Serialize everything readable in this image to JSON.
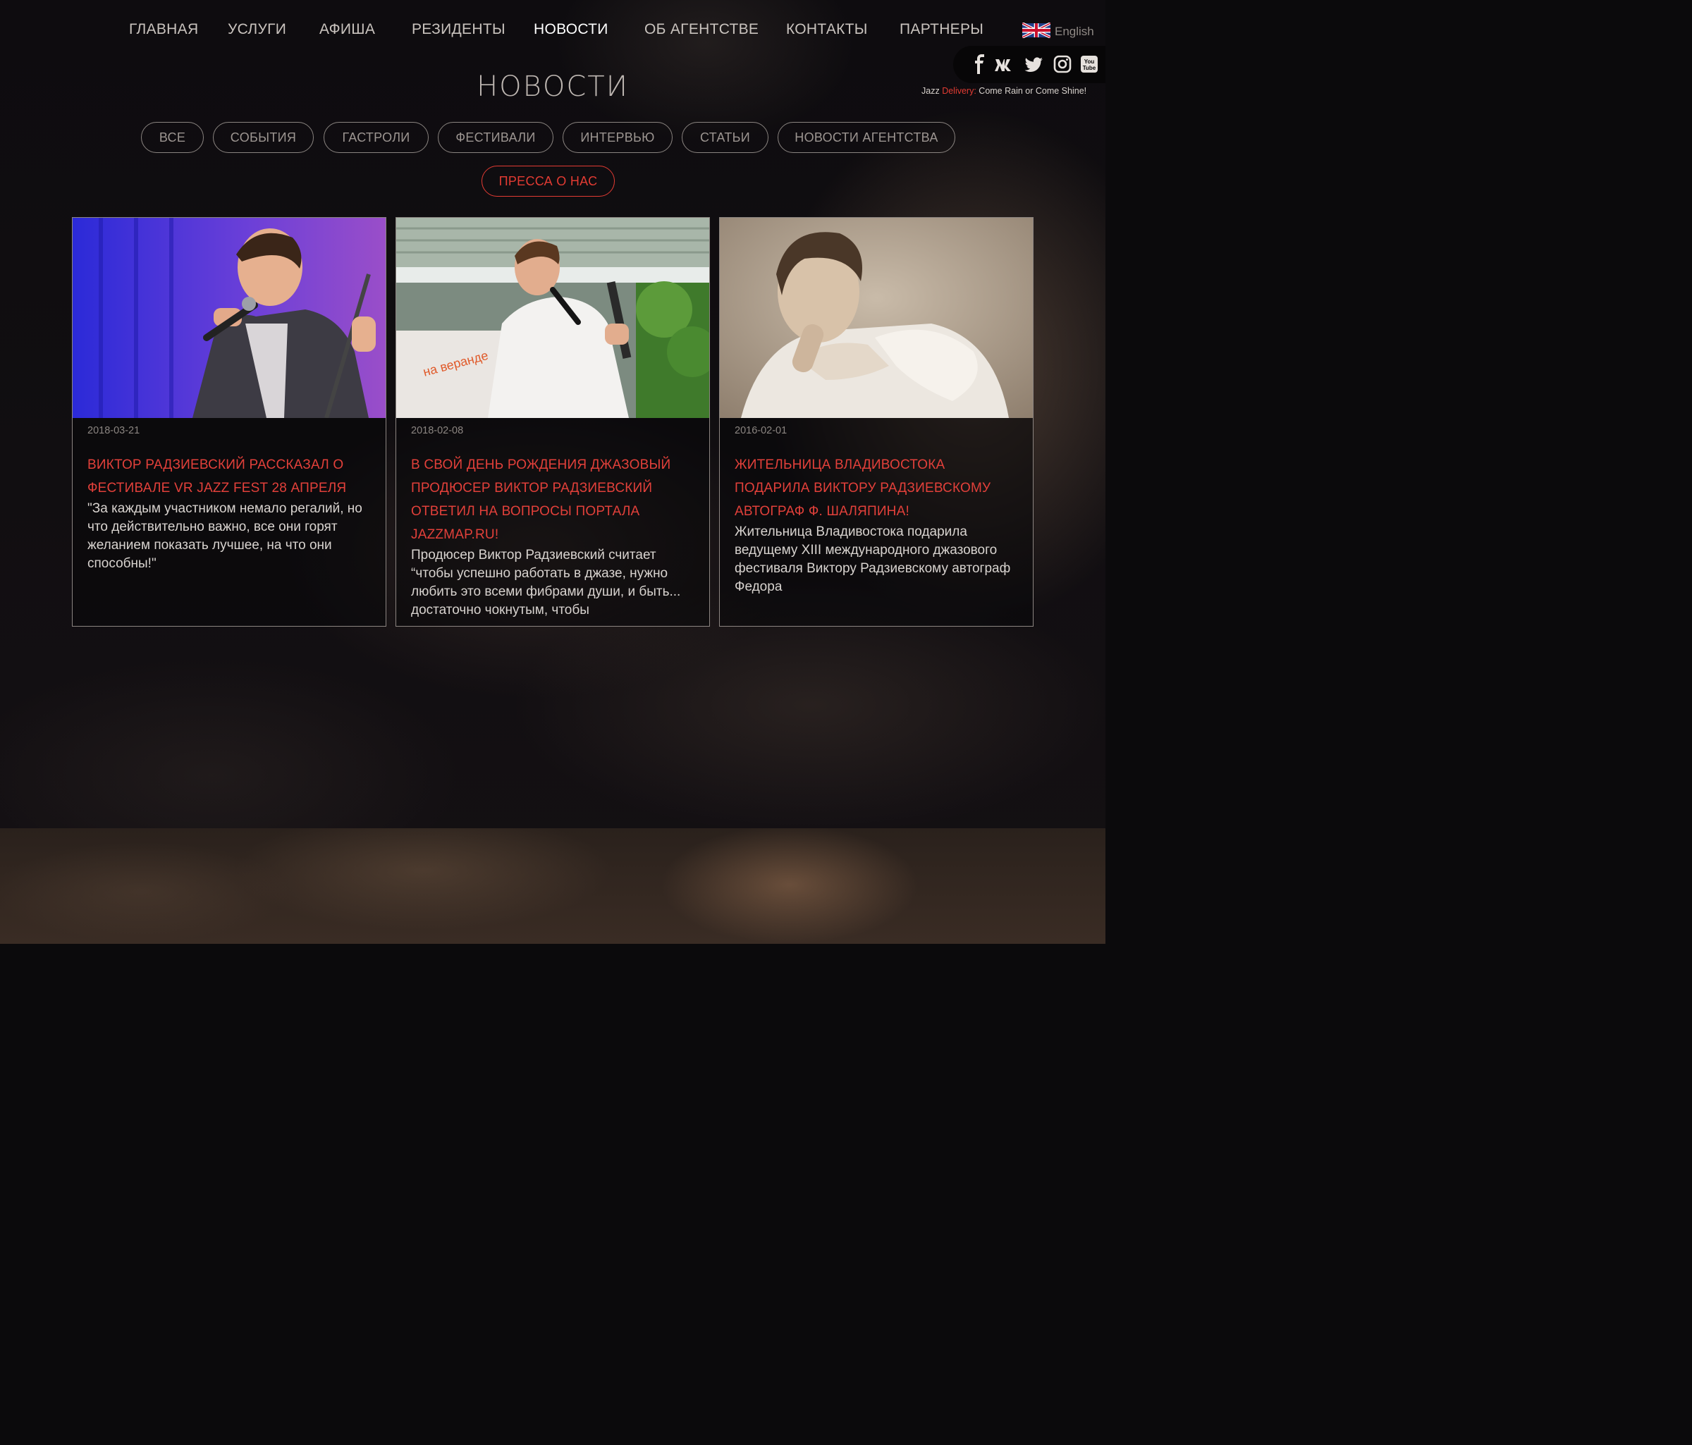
{
  "nav": {
    "items": [
      {
        "label": "ГЛАВНАЯ",
        "active": false
      },
      {
        "label": "УСЛУГИ",
        "active": false
      },
      {
        "label": "АФИША",
        "active": false
      },
      {
        "label": "РЕЗИДЕНТЫ",
        "active": false
      },
      {
        "label": "НОВОСТИ",
        "active": true
      },
      {
        "label": "ОБ АГЕНТСТВЕ",
        "active": false
      },
      {
        "label": "КОНТАКТЫ",
        "active": false
      },
      {
        "label": "ПАРТНЕРЫ",
        "active": false
      }
    ],
    "language": {
      "label": "English",
      "icon": "uk-flag-icon"
    }
  },
  "social": {
    "icons": [
      "facebook-icon",
      "vk-icon",
      "twitter-icon",
      "instagram-icon",
      "youtube-icon"
    ]
  },
  "tagline": {
    "prefix": "Jazz ",
    "accent": "Delivery:",
    "rest": " Come Rain or Come Shine!"
  },
  "page": {
    "title": "НОВОСТИ"
  },
  "filters": [
    {
      "label": "ВСЕ",
      "active": false
    },
    {
      "label": "СОБЫТИЯ",
      "active": false
    },
    {
      "label": "ГАСТРОЛИ",
      "active": false
    },
    {
      "label": "ФЕСТИВАЛИ",
      "active": false
    },
    {
      "label": "ИНТЕРВЬЮ",
      "active": false
    },
    {
      "label": "СТАТЬИ",
      "active": false
    },
    {
      "label": "НОВОСТИ АГЕНТСТВА",
      "active": false
    },
    {
      "label": "ПРЕССА О НАС",
      "active": true
    }
  ],
  "news": [
    {
      "date": "2018-03-21",
      "title": "Виктор Радзиевский рассказал о фестивале VR Jazz Fest 28 апреля",
      "excerpt": "\"За каждым участником немало регалий, но что действительно важно, все они горят желанием показать лучшее, на что они способны!\""
    },
    {
      "date": "2018-02-08",
      "title": "В свой день рождения джазовый продюсер Виктор Радзиевский ответил на вопросы портала Jazzmap.ru!",
      "excerpt": "Продюсер Виктор Радзиевский считает “чтобы успешно работать в джазе, нужно любить это всеми фибрами души, и быть... достаточно чокнутым, чтобы"
    },
    {
      "date": "2016-02-01",
      "title": "Жительница Владивостока подарила Виктору Радзиевскому автограф Ф. Шаляпина!",
      "excerpt": "Жительница Владивостока подарила ведущему XIII международного джазового фестиваля Виктору Радзиевскому автограф Федора"
    }
  ],
  "colors": {
    "accent": "#e23b33",
    "background": "#0b0a0c"
  }
}
